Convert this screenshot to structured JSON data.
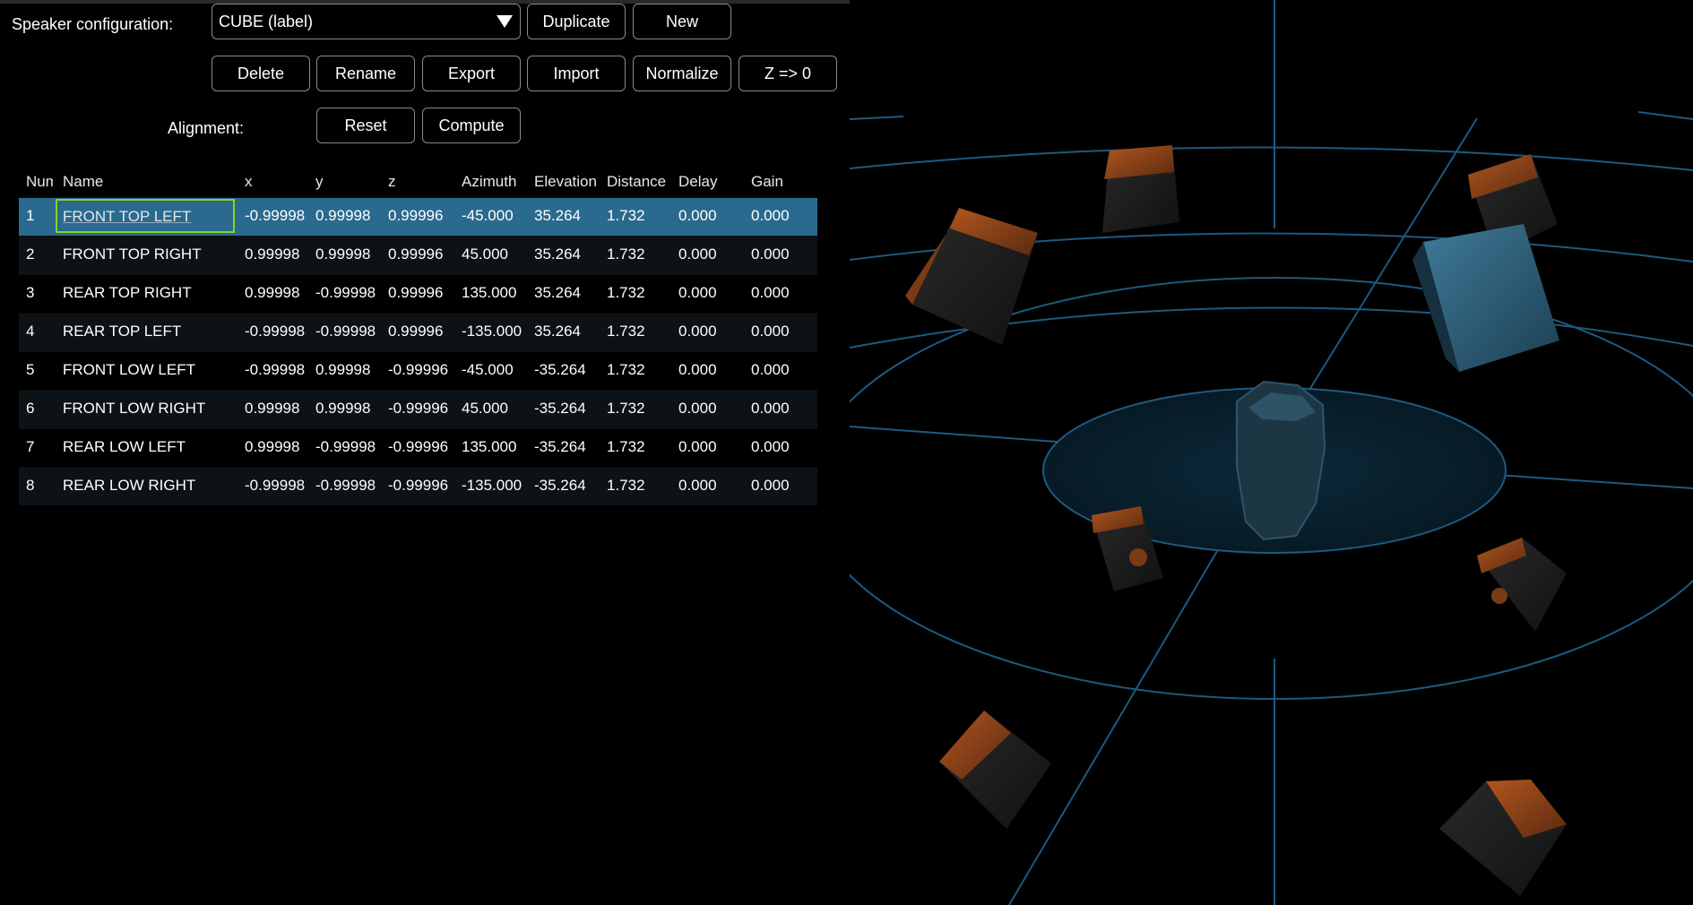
{
  "toolbar": {
    "speaker_config_label": "Speaker configuration:",
    "config_selected": "CUBE (label)",
    "duplicate": "Duplicate",
    "new": "New",
    "delete": "Delete",
    "rename": "Rename",
    "export": "Export",
    "import": "Import",
    "normalize": "Normalize",
    "z_zero": "Z => 0",
    "alignment_label": "Alignment:",
    "reset": "Reset",
    "compute": "Compute"
  },
  "table": {
    "headers": [
      "Num",
      "Name",
      "x",
      "y",
      "z",
      "Azimuth",
      "Elevation",
      "Distance",
      "Delay",
      "Gain"
    ],
    "rows": [
      [
        "1",
        "FRONT TOP LEFT",
        "-0.99998",
        "0.99998",
        "0.99996",
        "-45.000",
        "35.264",
        "1.732",
        "0.000",
        "0.000"
      ],
      [
        "2",
        "FRONT TOP RIGHT",
        "0.99998",
        "0.99998",
        "0.99996",
        "45.000",
        "35.264",
        "1.732",
        "0.000",
        "0.000"
      ],
      [
        "3",
        "REAR TOP RIGHT",
        "0.99998",
        "-0.99998",
        "0.99996",
        "135.000",
        "35.264",
        "1.732",
        "0.000",
        "0.000"
      ],
      [
        "4",
        "REAR TOP LEFT",
        "-0.99998",
        "-0.99998",
        "0.99996",
        "-135.000",
        "35.264",
        "1.732",
        "0.000",
        "0.000"
      ],
      [
        "5",
        "FRONT LOW LEFT",
        "-0.99998",
        "0.99998",
        "-0.99996",
        "-45.000",
        "-35.264",
        "1.732",
        "0.000",
        "0.000"
      ],
      [
        "6",
        "FRONT LOW RIGHT",
        "0.99998",
        "0.99998",
        "-0.99996",
        "45.000",
        "-35.264",
        "1.732",
        "0.000",
        "0.000"
      ],
      [
        "7",
        "REAR LOW LEFT",
        "0.99998",
        "-0.99998",
        "-0.99996",
        "135.000",
        "-35.264",
        "1.732",
        "0.000",
        "0.000"
      ],
      [
        "8",
        "REAR LOW RIGHT",
        "-0.99998",
        "-0.99998",
        "-0.99996",
        "-135.000",
        "-35.264",
        "1.732",
        "0.000",
        "0.000"
      ]
    ],
    "selected_row": 1
  },
  "colors": {
    "selected_row": "#2a6a8e",
    "focus_border": "#8ccf2b",
    "grid_line": "#1d5a80",
    "speaker_body": "#9a4a1c",
    "highlight_speaker": "#2c5d78"
  },
  "viewport": {
    "icons": [
      "head-model-icon",
      "speaker-cube-icon"
    ]
  }
}
